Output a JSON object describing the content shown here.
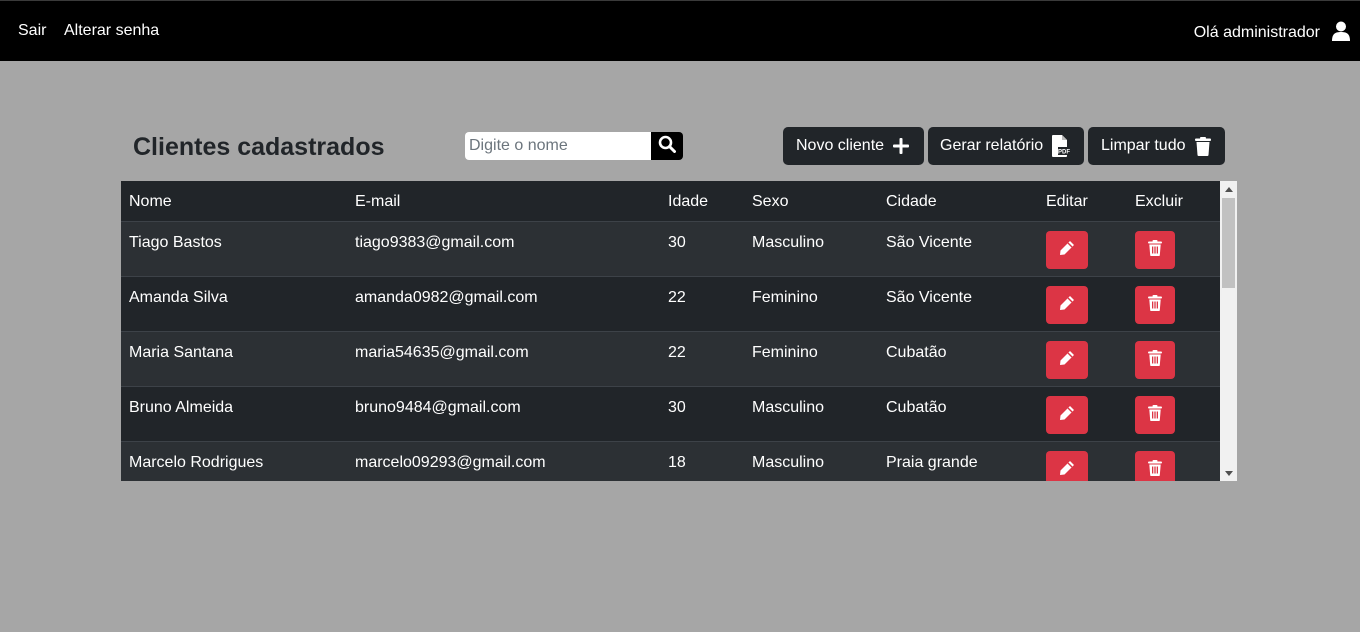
{
  "topbar": {
    "logout": "Sair",
    "change_password": "Alterar senha",
    "greeting": "Olá administrador"
  },
  "main": {
    "title": "Clientes cadastrados",
    "search_placeholder": "Digite o nome",
    "new_client": "Novo cliente",
    "report": "Gerar relatório",
    "clear_all": "Limpar tudo"
  },
  "table": {
    "headers": [
      "Nome",
      "E-mail",
      "Idade",
      "Sexo",
      "Cidade",
      "Editar",
      "Excluir"
    ],
    "rows": [
      {
        "nome": "Tiago Bastos",
        "email": "tiago9383@gmail.com",
        "idade": "30",
        "sexo": "Masculino",
        "cidade": "São Vicente"
      },
      {
        "nome": "Amanda Silva",
        "email": "amanda0982@gmail.com",
        "idade": "22",
        "sexo": "Feminino",
        "cidade": "São Vicente"
      },
      {
        "nome": "Maria Santana",
        "email": "maria54635@gmail.com",
        "idade": "22",
        "sexo": "Feminino",
        "cidade": "Cubatão"
      },
      {
        "nome": "Bruno Almeida",
        "email": "bruno9484@gmail.com",
        "idade": "30",
        "sexo": "Masculino",
        "cidade": "Cubatão"
      },
      {
        "nome": "Marcelo Rodrigues",
        "email": "marcelo09293@gmail.com",
        "idade": "18",
        "sexo": "Masculino",
        "cidade": "Praia grande"
      }
    ]
  },
  "colors": {
    "topbar": "#000000",
    "background": "#a6a6a6",
    "table_dark": "#212529",
    "table_stripe": "#2c3034",
    "danger": "#dc3545"
  },
  "icons": [
    "user-icon",
    "search-icon",
    "plus-icon",
    "pdf-file-icon",
    "trash-icon",
    "pencil-icon"
  ]
}
